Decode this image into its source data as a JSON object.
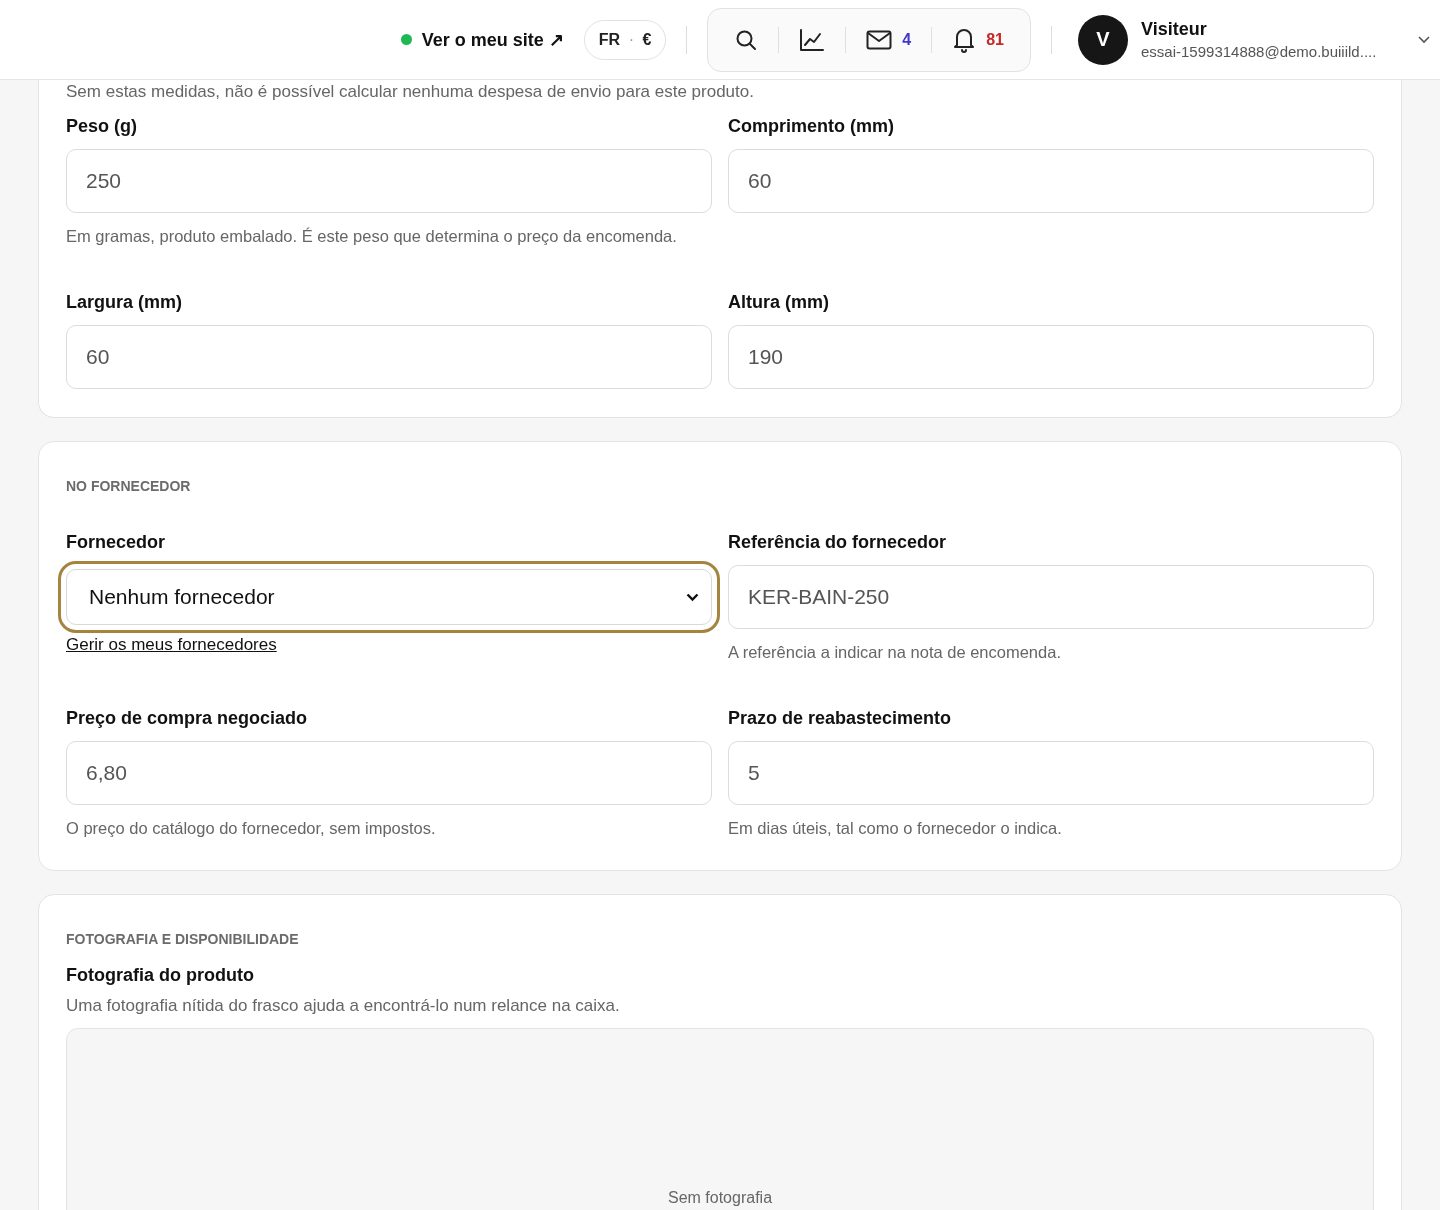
{
  "header": {
    "site_link": "Ver o meu site ↗",
    "locale": {
      "language": "FR",
      "separator": "·",
      "currency": "€"
    },
    "tools": [
      {
        "kind": "search"
      },
      {
        "kind": "chart"
      },
      {
        "kind": "mail",
        "count": "4",
        "color": "#4338ca"
      },
      {
        "kind": "bell",
        "count": "81",
        "color": "#c62828"
      }
    ],
    "user": {
      "initial": "V",
      "name": "Visiteur",
      "email": "essai-1599314888@demo.buiiild...."
    }
  },
  "sections": [
    {
      "intro": "Sem estas medidas, não é possível calcular nenhuma despesa de envio para este produto.",
      "fields": [
        {
          "kind": "input",
          "label": "Peso (g)",
          "value": "250",
          "help": "Em gramas, produto embalado. É este peso que determina o preço da encomenda."
        },
        {
          "kind": "input",
          "label": "Comprimento (mm)",
          "value": "60"
        },
        {
          "kind": "input",
          "label": "Largura (mm)",
          "value": "60"
        },
        {
          "kind": "input",
          "label": "Altura (mm)",
          "value": "190"
        }
      ]
    },
    {
      "heading": "NO FORNECEDOR",
      "fields": [
        {
          "kind": "select",
          "label": "Fornecedor",
          "value": "Nenhum fornecedor",
          "focused": true,
          "link": "Gerir os meus fornecedores"
        },
        {
          "kind": "input",
          "label": "Referência do fornecedor",
          "value": "KER-BAIN-250",
          "help": "A referência a indicar na nota de encomenda."
        },
        {
          "kind": "input",
          "label": "Preço de compra negociado",
          "value": "6,80",
          "help": "O preço do catálogo do fornecedor, sem impostos."
        },
        {
          "kind": "input",
          "label": "Prazo de reabastecimento",
          "value": "5",
          "help": "Em dias úteis, tal como o fornecedor o indica."
        }
      ]
    },
    {
      "heading": "FOTOGRAFIA E DISPONIBILIDADE",
      "photo": {
        "label": "Fotografia do produto",
        "help": "Uma fotografia nítida do frasco ajuda a encontrá-lo num relance na caixa.",
        "empty": "Sem fotografia"
      }
    }
  ]
}
